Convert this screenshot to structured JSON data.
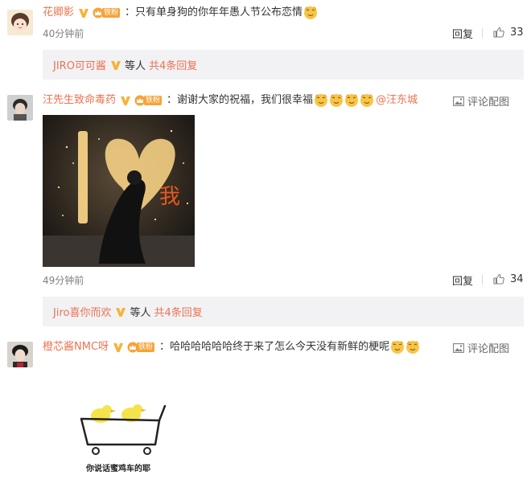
{
  "comments": [
    {
      "username": "花卿影",
      "fan_tag": "铁粉",
      "colon": "：",
      "text": "只有单身狗的你年年愚人节公布恋情",
      "time": "40分钟前",
      "reply": "回复",
      "likes": "33",
      "sub": {
        "name": "JIRO可可酱",
        "text": "等人",
        "count": "共4条回复"
      }
    },
    {
      "username": "汪先生致命毒药",
      "fan_tag": "铁粉",
      "colon": "：",
      "text": "谢谢大家的祝福，我们很幸福",
      "mention": "@汪东城",
      "pic_link": "评论配图",
      "photo_overlay": "我",
      "time": "49分钟前",
      "reply": "回复",
      "likes": "34",
      "sub": {
        "name": "Jiro喜你而欢",
        "text": "等人",
        "count": "共4条回复"
      }
    },
    {
      "username": "橙芯酱NMC呀",
      "fan_tag": "铁粉",
      "colon": "：",
      "text": "哈哈哈哈哈哈终于来了怎么今天没有新鲜的梗呢",
      "pic_link": "评论配图",
      "photo_caption": "你说话蜜鸡车的耶"
    }
  ],
  "colors": {
    "accent": "#eb7350",
    "fan_badge": "#f7a338",
    "sub_bg": "#f2f2f5"
  }
}
